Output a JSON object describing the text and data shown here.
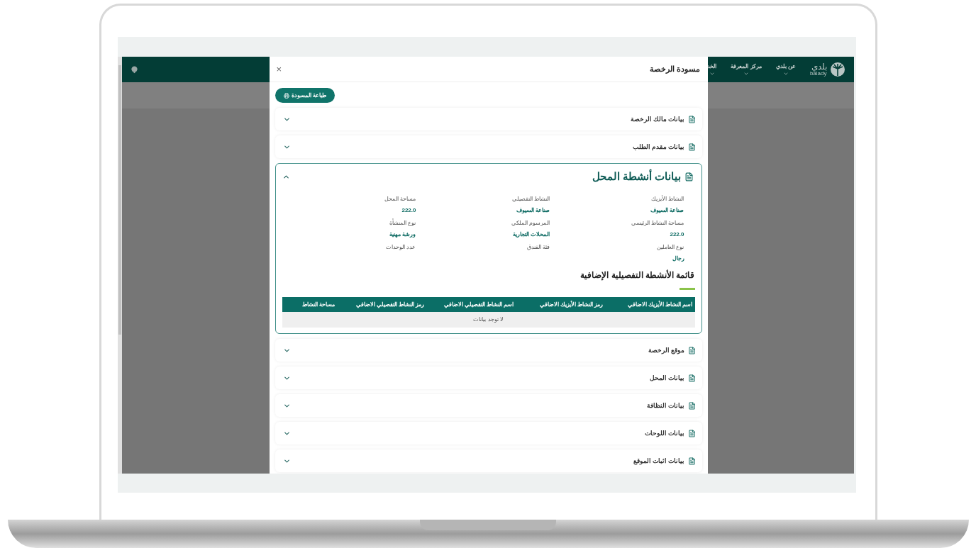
{
  "app_header": {
    "logo_text": "بلدي",
    "logo_subtext": "balady",
    "nav": [
      {
        "label": "عن بلدي"
      },
      {
        "label": "مركز المعرفة"
      },
      {
        "label": "الخد"
      }
    ]
  },
  "modal": {
    "title": "مسودة الرخصة",
    "close": "×",
    "print_button": "طباعة المسودة",
    "sections": [
      {
        "title": "بيانات مالك الرخصة",
        "expanded": false
      },
      {
        "title": "بيانات مقدم الطلب",
        "expanded": false
      },
      {
        "title": "بيانات أنشطة المحل",
        "expanded": true,
        "fields": [
          {
            "label": "النشاط الأيزيك",
            "value": "صناعة السيوف"
          },
          {
            "label": "النشاط التفصيلي",
            "value": "صناعة السيوف"
          },
          {
            "label": "مساحة المحل",
            "value": "222.0"
          },
          {
            "label": "مساحة النشاط الرئيسي",
            "value": "222.0"
          },
          {
            "label": "المرسوم الملكي",
            "value": "المحلات التجارية"
          },
          {
            "label": "نوع المنشأة",
            "value": "ورشة مهنية"
          },
          {
            "label": "نوع العاملين",
            "value": "رجال"
          },
          {
            "label": "فئة الفندق"
          },
          {
            "label": "عدد الوحدات"
          }
        ],
        "table_title": "قائمة الأنشطة التفصيلية الإضافية",
        "columns": [
          "اسم النشاط الأيزيك الاضافي",
          "رمز النشاط الأيزيك الاضافي",
          "اسم النشاط التفصيلي الاضافي",
          "رمز النشاط التفصيلي الاضافي",
          "مساحة النشاط"
        ],
        "empty_text": "لا توجد بيانات"
      },
      {
        "title": "موقع الرخصة",
        "expanded": false
      },
      {
        "title": "بيانات المحل",
        "expanded": false
      },
      {
        "title": "بيانات النظافة",
        "expanded": false
      },
      {
        "title": "بيانات اللوحات",
        "expanded": false
      },
      {
        "title": "بيانات اثبات الموقع",
        "expanded": false
      }
    ]
  }
}
